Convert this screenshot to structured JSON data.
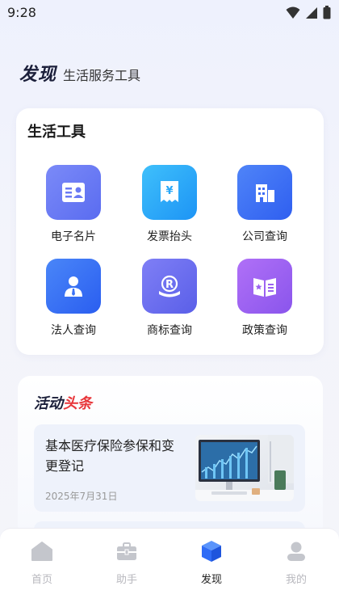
{
  "status_bar": {
    "time": "9:28"
  },
  "header": {
    "title": "发现",
    "subtitle": "生活服务工具"
  },
  "tools_card": {
    "title": "生活工具",
    "items": [
      {
        "label": "电子名片",
        "icon": "business-card-icon",
        "color": "#6878f4"
      },
      {
        "label": "发票抬头",
        "icon": "invoice-icon",
        "color": "#2aa8f8"
      },
      {
        "label": "公司查询",
        "icon": "building-icon",
        "color": "#3d6df5"
      },
      {
        "label": "法人查询",
        "icon": "person-icon",
        "color": "#3b72f6"
      },
      {
        "label": "商标查询",
        "icon": "trademark-icon",
        "color": "#6b6ff0"
      },
      {
        "label": "政策查询",
        "icon": "policy-book-icon",
        "color": "#9a62f0"
      }
    ]
  },
  "news_card": {
    "title_part1": "活动",
    "title_part2": "头条",
    "items": [
      {
        "headline": "基本医疗保险参保和变更登记",
        "date": "2025年7月31日"
      }
    ]
  },
  "tab_bar": {
    "tabs": [
      {
        "label": "首页",
        "icon": "home-icon",
        "active": false
      },
      {
        "label": "助手",
        "icon": "briefcase-icon",
        "active": false
      },
      {
        "label": "发现",
        "icon": "cube-icon",
        "active": true
      },
      {
        "label": "我的",
        "icon": "user-icon",
        "active": false
      }
    ]
  },
  "colors": {
    "accent": "#2f6cf6",
    "headline_red": "#e8363a",
    "inactive_tab": "#b8b8be"
  }
}
